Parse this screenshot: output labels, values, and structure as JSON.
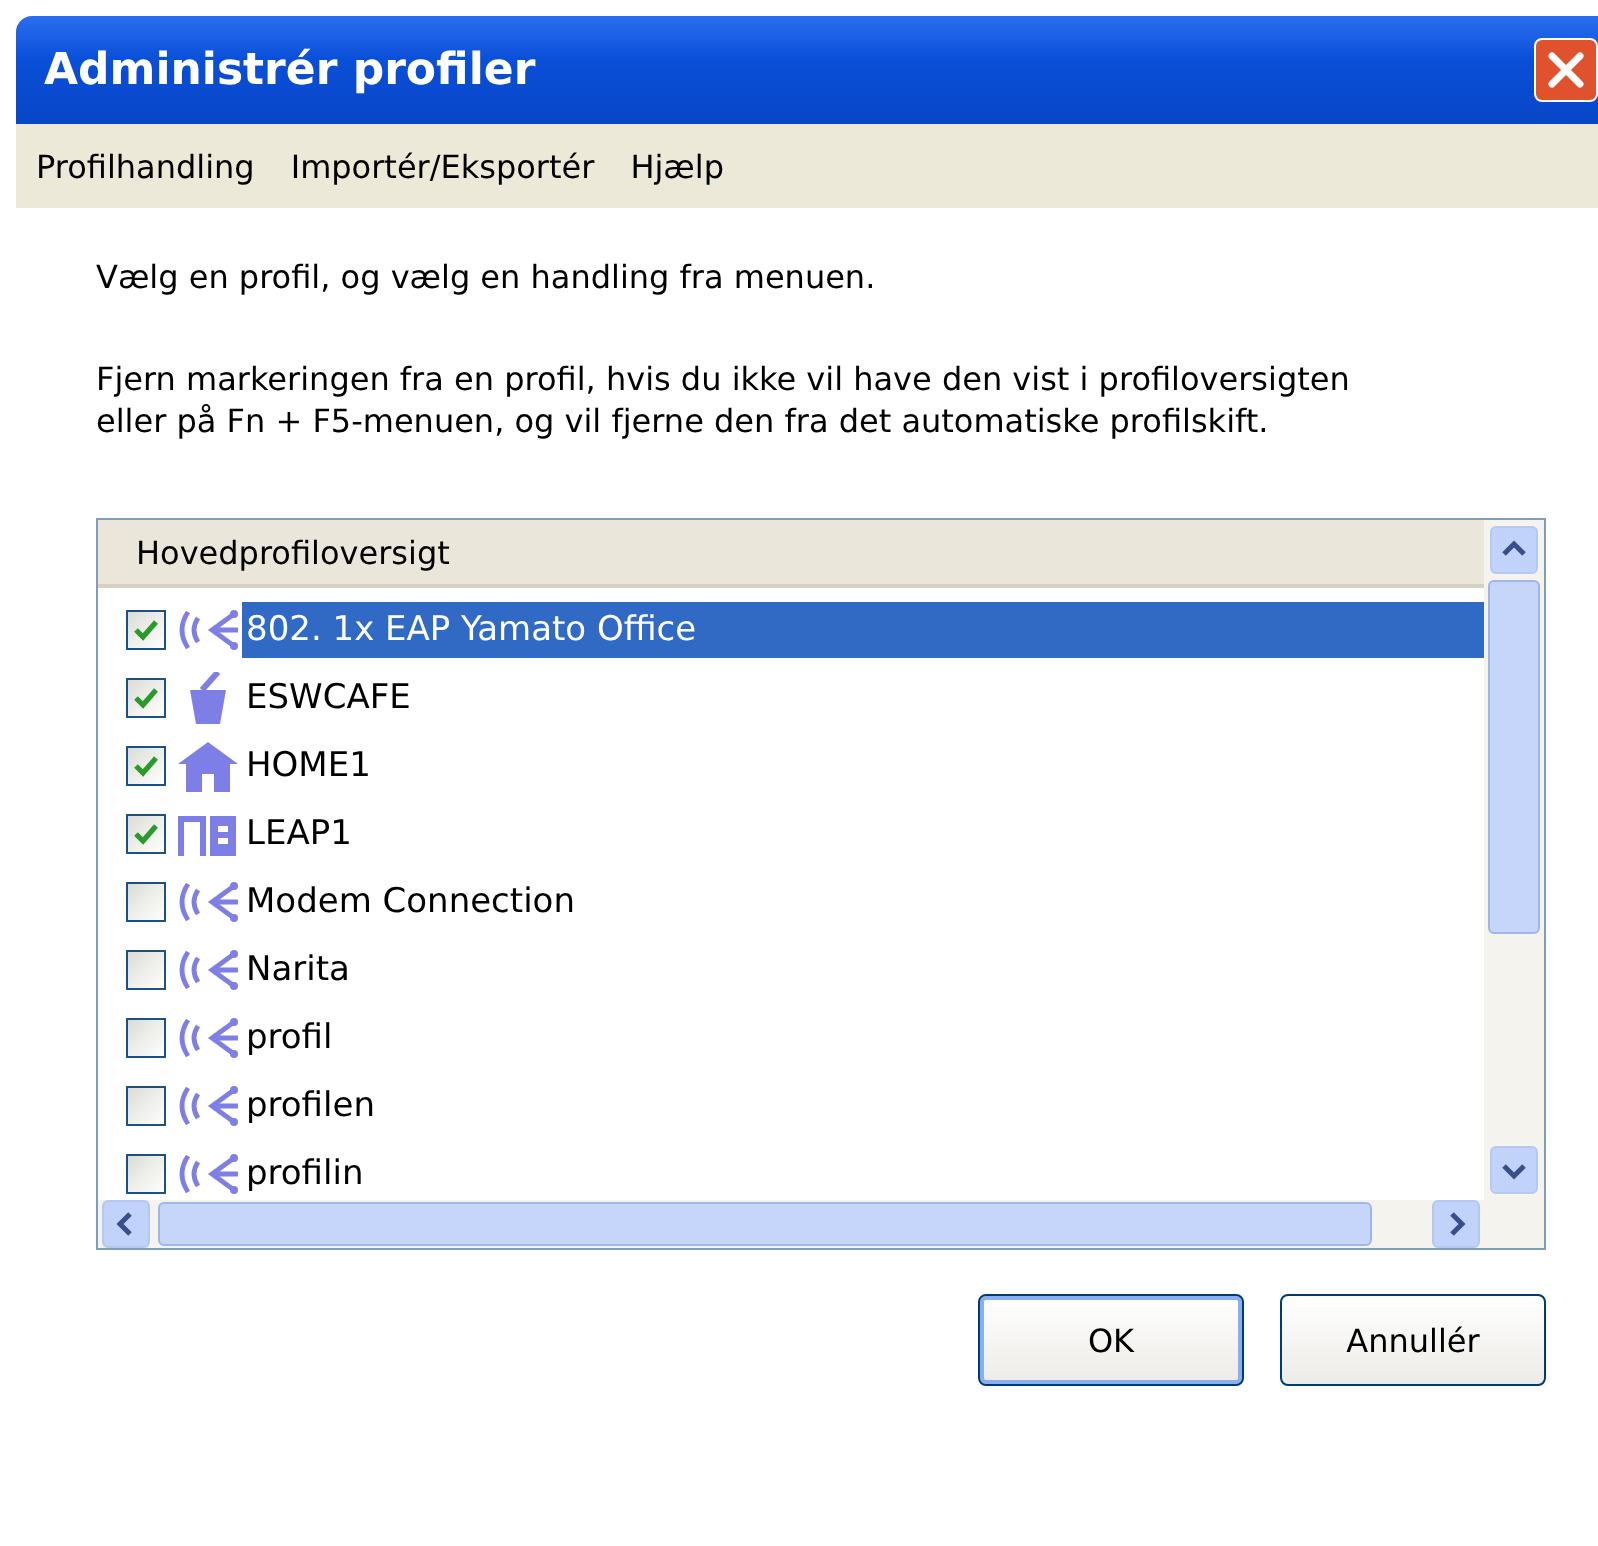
{
  "window": {
    "title": "Administrér profiler"
  },
  "menu": [
    "Profilhandling",
    "Importér/Eksportér",
    "Hjælp"
  ],
  "instructions": [
    "Vælg en profil, og vælg en handling fra menuen.",
    "Fjern markeringen fra en profil, hvis du ikke vil have den vist i profiloversigten eller på Fn + F5-menuen, og vil fjerne den fra det automatiske profilskift."
  ],
  "list": {
    "header": "Hovedprofiloversigt",
    "items": [
      {
        "name": "802. 1x EAP Yamato Office",
        "kind": "wireless",
        "checked": true,
        "selected": true
      },
      {
        "name": "ESWCAFE",
        "kind": "cafe",
        "checked": true,
        "selected": false
      },
      {
        "name": "HOME1",
        "kind": "home",
        "checked": true,
        "selected": false
      },
      {
        "name": "LEAP1",
        "kind": "office",
        "checked": true,
        "selected": false
      },
      {
        "name": "Modem Connection",
        "kind": "wireless",
        "checked": false,
        "selected": false
      },
      {
        "name": "Narita",
        "kind": "wireless",
        "checked": false,
        "selected": false
      },
      {
        "name": "profil",
        "kind": "wireless",
        "checked": false,
        "selected": false
      },
      {
        "name": "profilen",
        "kind": "wireless",
        "checked": false,
        "selected": false
      },
      {
        "name": "profilin",
        "kind": "wireless",
        "checked": false,
        "selected": false
      }
    ]
  },
  "buttons": [
    "OK",
    "Annullér"
  ]
}
